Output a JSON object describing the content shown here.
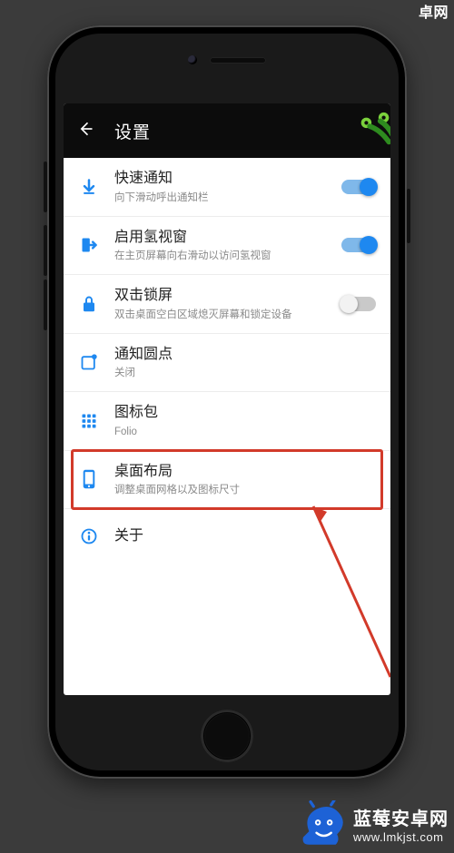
{
  "header": {
    "title": "设置"
  },
  "items": [
    {
      "key": "quick_notify",
      "title": "快速通知",
      "sub": "向下滑动呼出通知栏",
      "toggle": "on"
    },
    {
      "key": "hydrogen",
      "title": "启用氢视窗",
      "sub": "在主页屏幕向右滑动以访问氢视窗",
      "toggle": "on"
    },
    {
      "key": "dbl_lock",
      "title": "双击锁屏",
      "sub": "双击桌面空白区域熄灭屏幕和锁定设备",
      "toggle": "off"
    },
    {
      "key": "dot",
      "title": "通知圆点",
      "sub": "关闭"
    },
    {
      "key": "iconpack",
      "title": "图标包",
      "sub": "Folio"
    },
    {
      "key": "layout",
      "title": "桌面布局",
      "sub": "调整桌面网格以及图标尺寸",
      "highlight": true
    },
    {
      "key": "about",
      "title": "关于"
    }
  ],
  "watermark": {
    "title": "蓝莓安卓网",
    "url": "www.lmkjst.com"
  },
  "colors": {
    "accent": "#1e88f0",
    "highlight": "#d23a2a"
  }
}
